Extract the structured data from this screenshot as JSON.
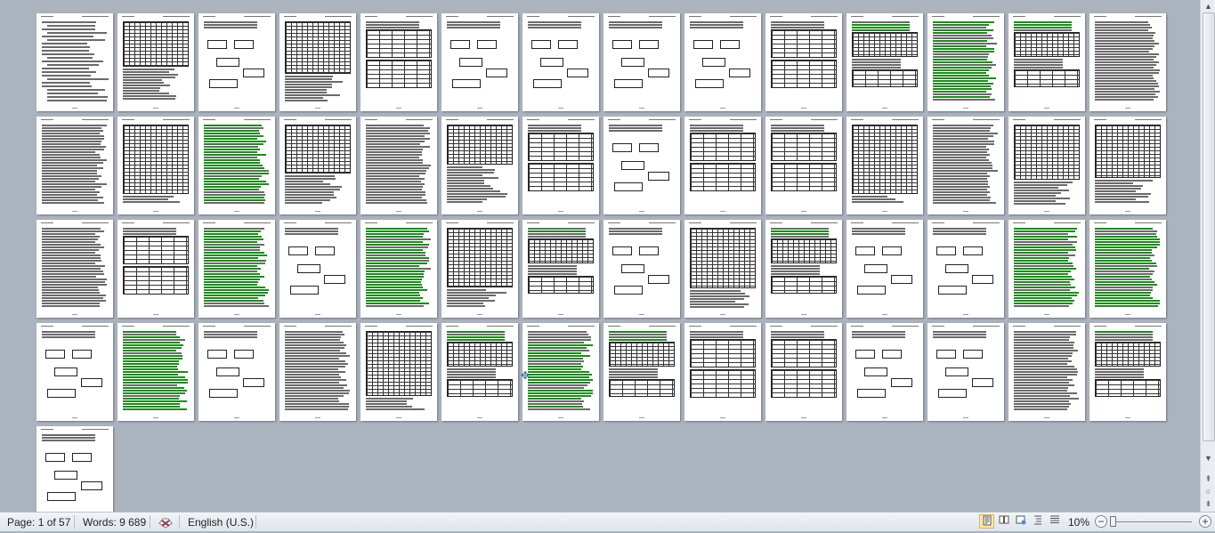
{
  "document": {
    "page_count": 57
  },
  "status_bar": {
    "page_label": "Page: 1 of 57",
    "words_label": "Words: 9 689",
    "proofing_icon": "spellcheck-x-icon",
    "language_label": "English (U.S.)",
    "views": [
      {
        "name": "print-layout-view",
        "icon": "print-layout-icon",
        "active": true
      },
      {
        "name": "full-screen-reading-view",
        "icon": "book-icon",
        "active": false
      },
      {
        "name": "web-layout-view",
        "icon": "web-layout-icon",
        "active": false
      },
      {
        "name": "outline-view",
        "icon": "outline-icon",
        "active": false
      },
      {
        "name": "draft-view",
        "icon": "draft-icon",
        "active": false
      }
    ],
    "zoom_label": "10%",
    "zoom_out": "−",
    "zoom_in": "+"
  },
  "colors": {
    "workspace": "#abb3bf",
    "page": "#ffffff",
    "highlight_green": "#1f8a1f",
    "status_bg": "#e6ebf1"
  }
}
